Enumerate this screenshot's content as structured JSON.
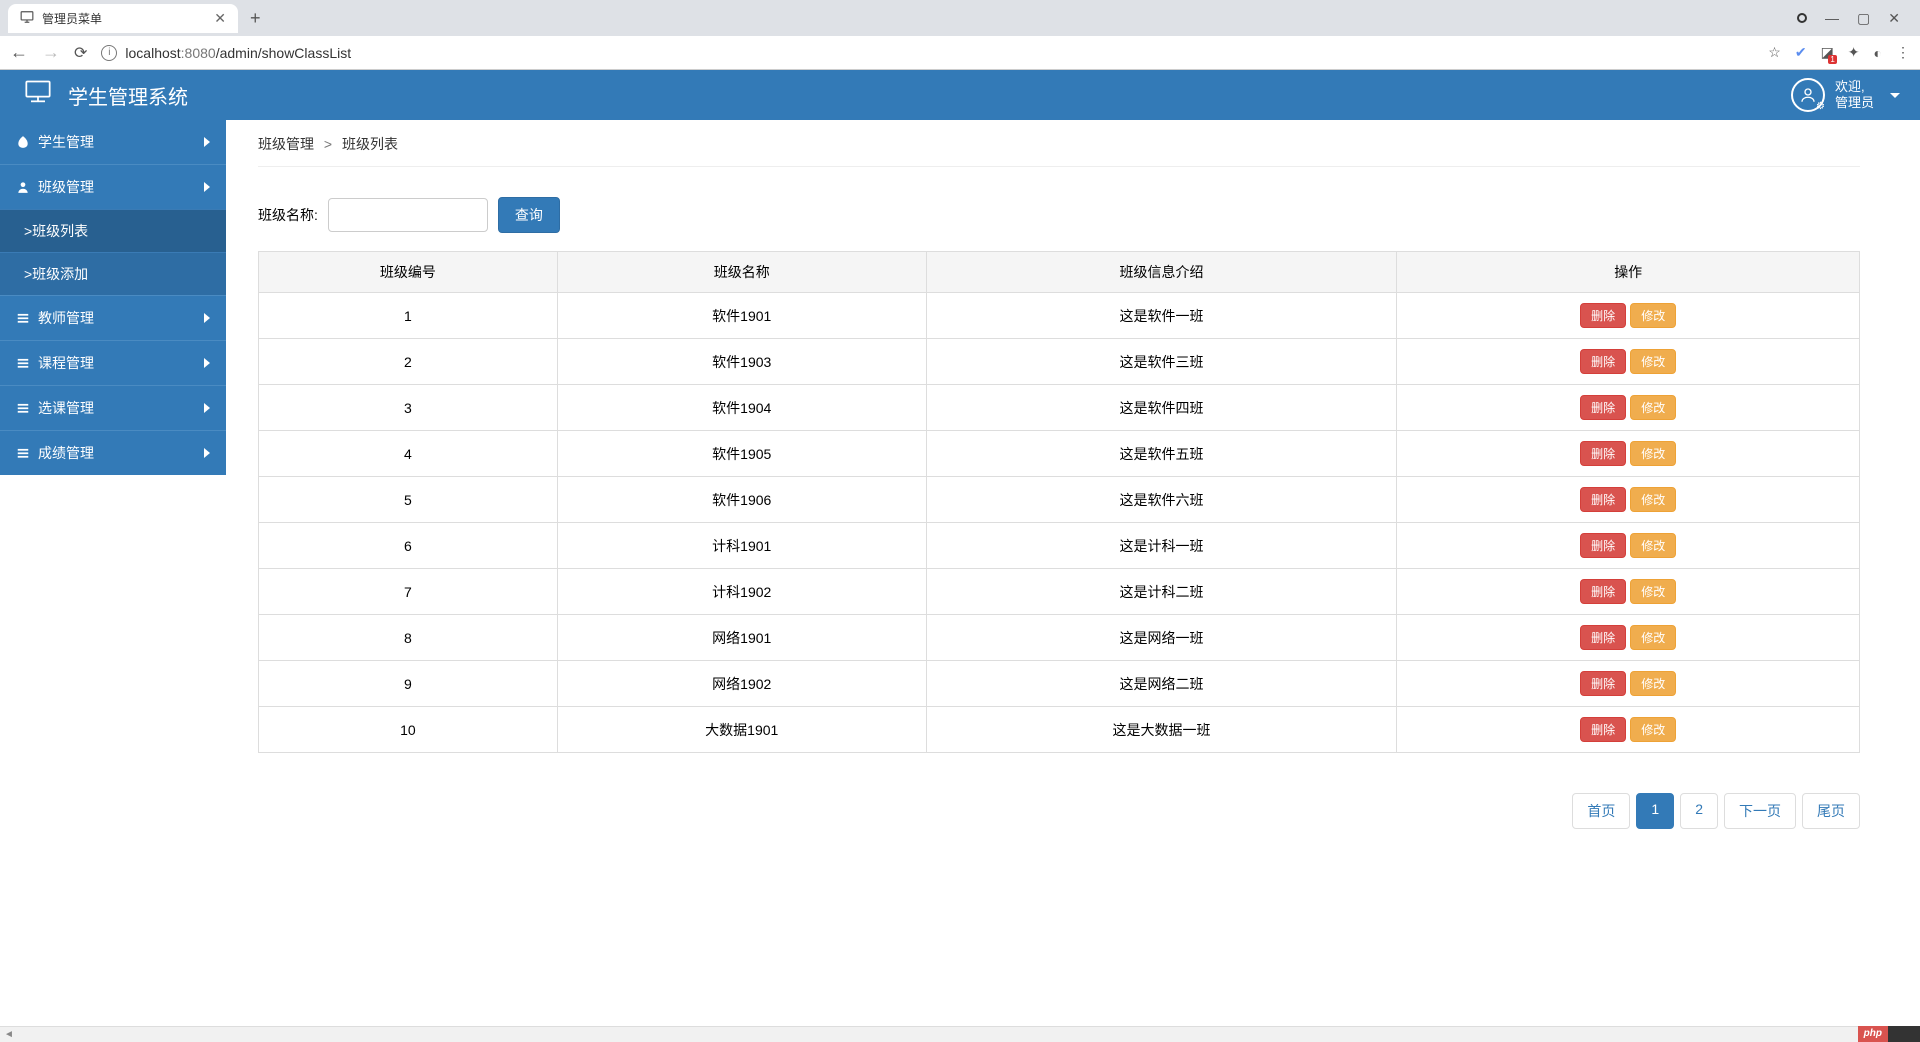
{
  "browser": {
    "tab_title": "管理员菜单",
    "url_host": "localhost",
    "url_port": ":8080",
    "url_path": "/admin/showClassList",
    "ext_badge": "1"
  },
  "header": {
    "app_title": "学生管理系统",
    "welcome_line1": "欢迎,",
    "welcome_line2": "管理员"
  },
  "sidebar": {
    "items": [
      {
        "label": "学生管理",
        "icon": "leaf"
      },
      {
        "label": "班级管理",
        "icon": "user",
        "expanded": true,
        "children": [
          {
            "label": ">班级列表",
            "active": true
          },
          {
            "label": ">班级添加"
          }
        ]
      },
      {
        "label": "教师管理",
        "icon": "list"
      },
      {
        "label": "课程管理",
        "icon": "list"
      },
      {
        "label": "选课管理",
        "icon": "list"
      },
      {
        "label": "成绩管理",
        "icon": "list"
      }
    ]
  },
  "breadcrumb": {
    "parent": "班级管理",
    "current": "班级列表"
  },
  "search": {
    "label": "班级名称:",
    "value": "",
    "button": "查询"
  },
  "table": {
    "headers": [
      "班级编号",
      "班级名称",
      "班级信息介绍",
      "操作"
    ],
    "actions": {
      "delete": "删除",
      "edit": "修改"
    },
    "rows": [
      {
        "id": "1",
        "name": "软件1901",
        "desc": "这是软件一班"
      },
      {
        "id": "2",
        "name": "软件1903",
        "desc": "这是软件三班"
      },
      {
        "id": "3",
        "name": "软件1904",
        "desc": "这是软件四班"
      },
      {
        "id": "4",
        "name": "软件1905",
        "desc": "这是软件五班"
      },
      {
        "id": "5",
        "name": "软件1906",
        "desc": "这是软件六班"
      },
      {
        "id": "6",
        "name": "计科1901",
        "desc": "这是计科一班"
      },
      {
        "id": "7",
        "name": "计科1902",
        "desc": "这是计科二班"
      },
      {
        "id": "8",
        "name": "网络1901",
        "desc": "这是网络一班"
      },
      {
        "id": "9",
        "name": "网络1902",
        "desc": "这是网络二班"
      },
      {
        "id": "10",
        "name": "大数据1901",
        "desc": "这是大数据一班"
      }
    ]
  },
  "pagination": {
    "first": "首页",
    "p1": "1",
    "p2": "2",
    "next": "下一页",
    "last": "尾页"
  },
  "status": {
    "php": "php"
  }
}
